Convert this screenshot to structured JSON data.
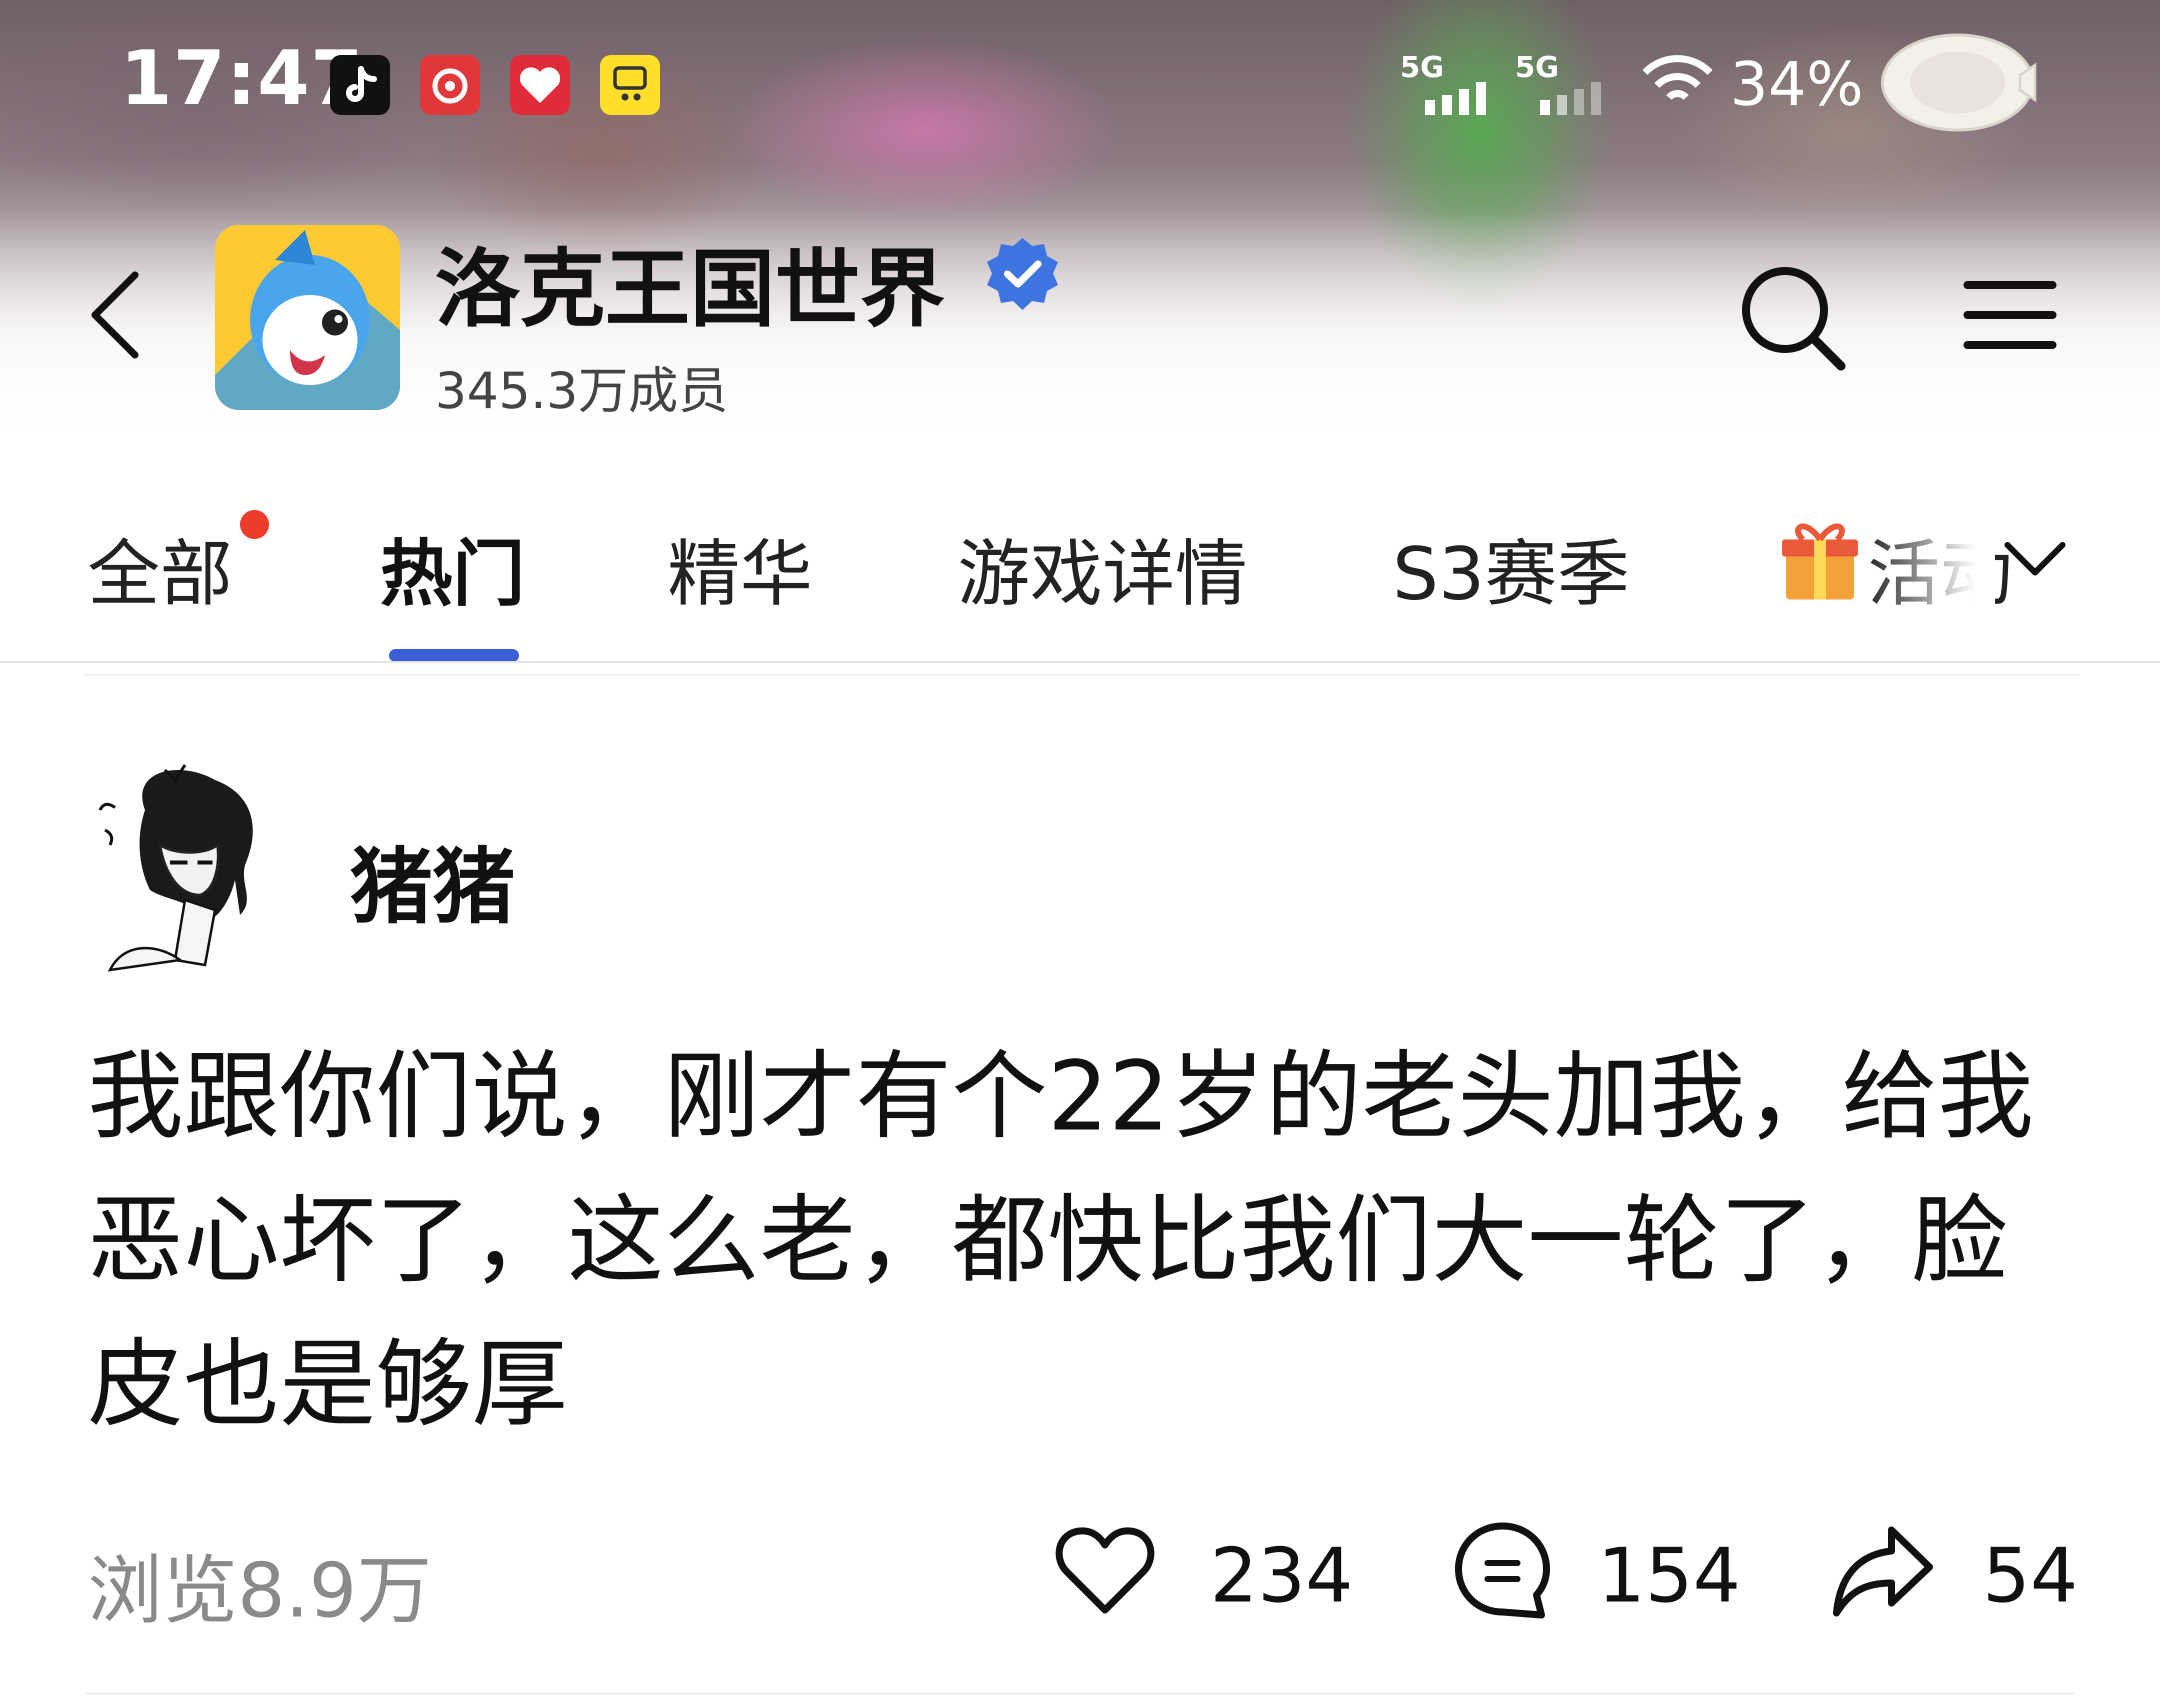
{
  "status_bar": {
    "time": "17:47",
    "apps": [
      "tiktok-icon",
      "netease-music-icon",
      "red-app-icon",
      "xianyu-icon"
    ],
    "signal_1": "5G",
    "signal_2": "5G",
    "battery": "34%"
  },
  "group": {
    "name": "洛克王国世界",
    "members": "345.3万成员",
    "verified": true
  },
  "tabs": [
    {
      "label": "全部",
      "has_dot": true
    },
    {
      "label": "热门",
      "active": true
    },
    {
      "label": "精华"
    },
    {
      "label": "游戏详情"
    },
    {
      "label": "S3赛季"
    },
    {
      "label": "活动",
      "icon": "gift-icon"
    }
  ],
  "post": {
    "author": "猪猪",
    "body": "我跟你们说，刚才有个22岁的老头加我，给我恶心坏了，这么老，都快比我们大一轮了，脸皮也是够厚",
    "views": "浏览8.9万",
    "likes": "234",
    "comments": "154",
    "shares": "54"
  },
  "colors": {
    "accent": "#3a5fd6",
    "badge": "#ec3c2c",
    "verified": "#3d74e0",
    "muted_text": "#8a8a8a"
  }
}
